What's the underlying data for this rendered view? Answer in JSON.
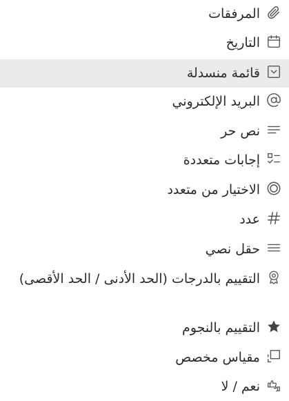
{
  "menu": {
    "items": [
      {
        "label": "المرفقات",
        "icon": "paperclip-icon"
      },
      {
        "label": "التاريخ",
        "icon": "calendar-icon"
      },
      {
        "label": "قائمة منسدلة",
        "icon": "dropdown-icon",
        "selected": true
      },
      {
        "label": "البريد الإلكتروني",
        "icon": "at-sign-icon"
      },
      {
        "label": "نص حر",
        "icon": "text-lines-icon"
      },
      {
        "label": "إجابات متعددة",
        "icon": "checklist-icon"
      },
      {
        "label": "الاختيار من متعدد",
        "icon": "radio-icon"
      },
      {
        "label": "عدد",
        "icon": "hash-icon"
      },
      {
        "label": "حقل نصي",
        "icon": "text-field-icon"
      },
      {
        "label": "التقييم بالدرجات (الحد الأدنى / الحد الأقصى)",
        "icon": "award-icon"
      },
      {
        "label": "التقييم بالنجوم",
        "icon": "star-icon"
      },
      {
        "label": "مقياس مخصص",
        "icon": "custom-scale-icon"
      },
      {
        "label": "نعم / لا",
        "icon": "thumbs-icon"
      }
    ]
  }
}
